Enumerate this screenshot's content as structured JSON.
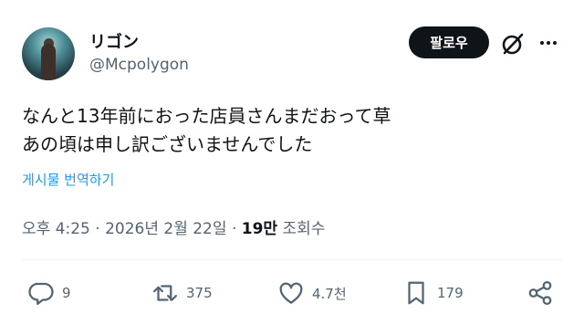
{
  "author": {
    "display_name": "リゴン",
    "handle": "@Mcpolygon"
  },
  "header": {
    "follow_label": "팔로우"
  },
  "tweet": {
    "lines": [
      "なんと13年前におった店員さんまだおって草",
      "あの頃は申し訳ございませんでした"
    ],
    "translate_label": "게시물 번역하기"
  },
  "meta": {
    "time": "오후 4:25",
    "separator": "·",
    "date": "2026년 2월 22일",
    "views_count": "19만",
    "views_label": "조회수"
  },
  "actions": {
    "replies": "9",
    "reposts": "375",
    "likes": "4.7천",
    "bookmarks": "179"
  },
  "icons": {
    "grok": "grok-icon",
    "more": "more-icon",
    "reply": "reply-icon",
    "repost": "repost-icon",
    "like": "heart-icon",
    "bookmark": "bookmark-icon",
    "share": "share-icon"
  },
  "colors": {
    "text": "#0f1419",
    "secondary": "#536471",
    "link": "#1d9bf0",
    "follow_bg": "#0f1419"
  }
}
